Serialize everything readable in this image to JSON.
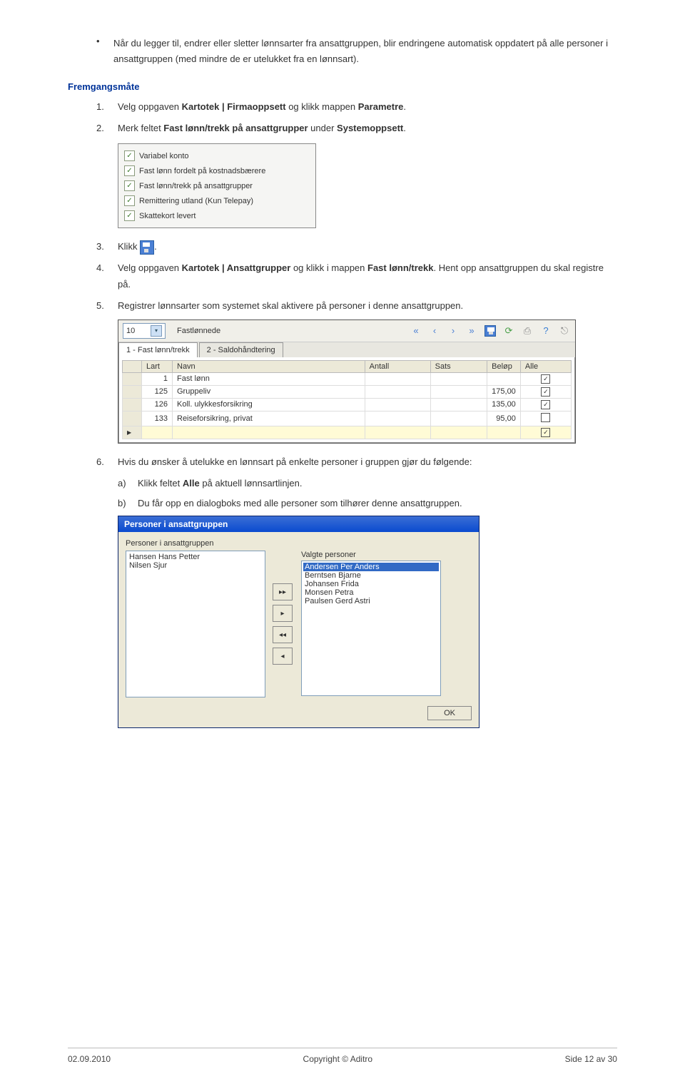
{
  "intro_bullet": "Når du legger til, endrer eller sletter lønnsarter fra ansattgruppen, blir endringene automatisk oppdatert på alle personer i ansattgruppen (med mindre de er utelukket fra en lønnsart).",
  "heading": "Fremgangsmåte",
  "steps": {
    "s1": {
      "n": "1.",
      "pre": "Velg oppgaven ",
      "b1": "Kartotek | Firmaoppsett",
      "mid": " og klikk mappen ",
      "b2": "Parametre",
      "post": "."
    },
    "s2": {
      "n": "2.",
      "pre": "Merk feltet ",
      "b1": "Fast lønn/trekk på ansattgrupper",
      "mid": " under ",
      "b2": "Systemoppsett",
      "post": "."
    },
    "s3": {
      "n": "3.",
      "pre": "Klikk ",
      "post": "."
    },
    "s4": {
      "n": "4.",
      "pre": "Velg oppgaven ",
      "b1": "Kartotek | Ansattgrupper",
      "mid": " og klikk i mappen ",
      "b2": "Fast lønn/trekk",
      "post": ". Hent opp ansattgruppen du skal registre på."
    },
    "s5": {
      "n": "5.",
      "text": "Registrer lønnsarter som systemet skal aktivere på personer i denne ansattgruppen."
    },
    "s6": {
      "n": "6.",
      "text": "Hvis du ønsker å utelukke en lønnsart på enkelte personer i gruppen gjør du følgende:"
    },
    "s6a": {
      "n": "a)",
      "pre": "Klikk feltet ",
      "b1": "Alle",
      "post": " på aktuell lønnsartlinjen."
    },
    "s6b": {
      "n": "b)",
      "text": "Du får opp en dialogboks med alle personer som tilhører denne ansattgruppen."
    }
  },
  "checkboxes": [
    "Variabel konto",
    "Fast lønn fordelt på kostnadsbærere",
    "Fast lønn/trekk på ansattgrupper",
    "Remittering utland (Kun Telepay)",
    "Skattekort levert"
  ],
  "table": {
    "group_id": "10",
    "group_name": "Fastlønnede",
    "tabs": [
      "1 - Fast lønn/trekk",
      "2 - Saldohåndtering"
    ],
    "headers": [
      "Lart",
      "Navn",
      "Antall",
      "Sats",
      "Beløp",
      "Alle"
    ],
    "rows": [
      {
        "lart": "1",
        "navn": "Fast lønn",
        "antall": "",
        "sats": "",
        "belop": "",
        "alle": true
      },
      {
        "lart": "125",
        "navn": "Gruppeliv",
        "antall": "",
        "sats": "",
        "belop": "175,00",
        "alle": true
      },
      {
        "lart": "126",
        "navn": "Koll. ulykkesforsikring",
        "antall": "",
        "sats": "",
        "belop": "135,00",
        "alle": true
      },
      {
        "lart": "133",
        "navn": "Reiseforsikring, privat",
        "antall": "",
        "sats": "",
        "belop": "95,00",
        "alle": false
      }
    ]
  },
  "dialog": {
    "title": "Personer i ansattgruppen",
    "left_label": "Personer i ansattgruppen",
    "right_label": "Valgte personer",
    "left": [
      "Hansen Hans Petter",
      "Nilsen Sjur"
    ],
    "right": [
      "Andersen Per Anders",
      "Berntsen Bjarne",
      "Johansen Frida",
      "Monsen Petra",
      "Paulsen Gerd Astri"
    ],
    "ok": "OK"
  },
  "footer": {
    "date": "02.09.2010",
    "copyright": "Copyright © Aditro",
    "page": "Side 12 av 30"
  }
}
